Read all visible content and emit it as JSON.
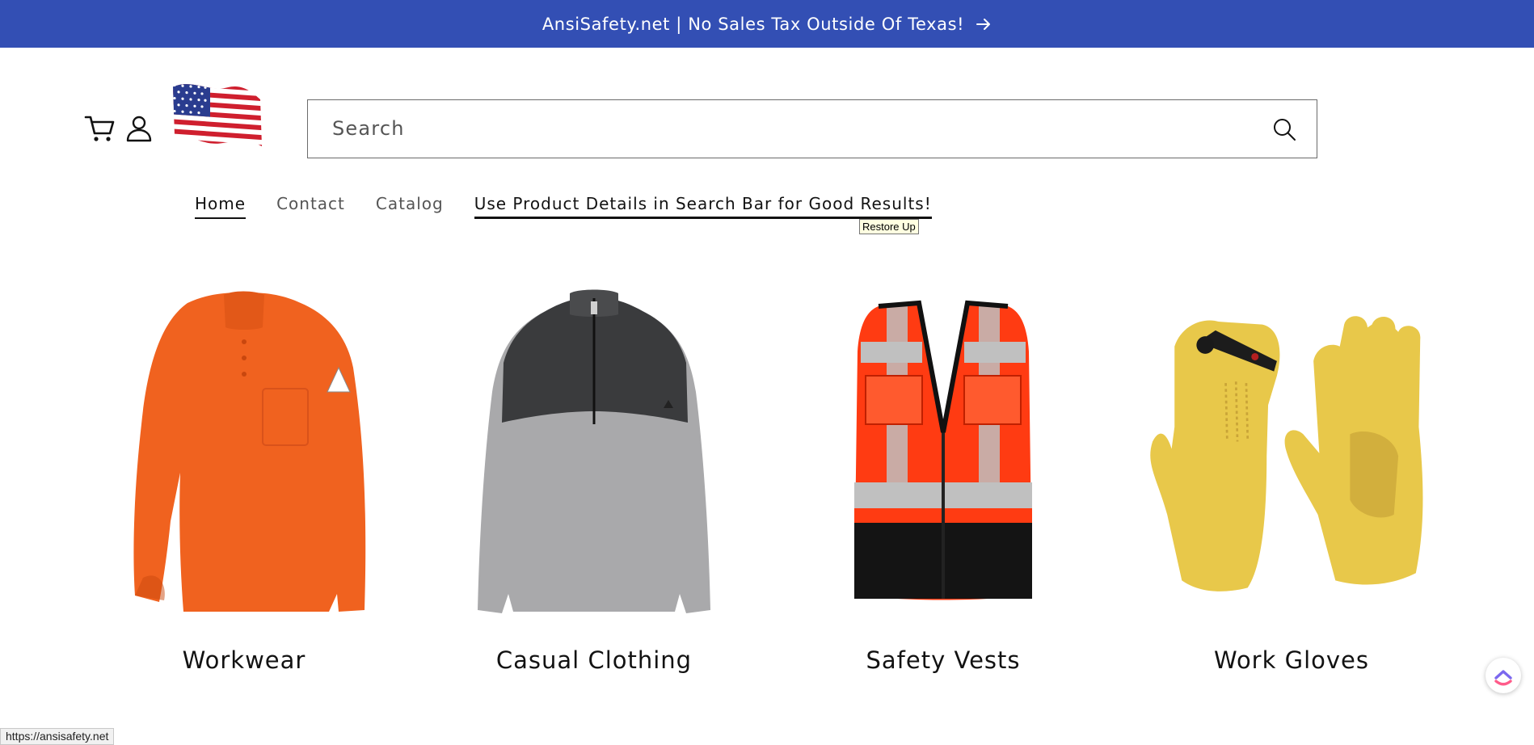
{
  "announcement": {
    "text": "AnsiSafety.net | No Sales Tax Outside Of Texas!",
    "icon": "arrow-right-icon"
  },
  "header": {
    "cart_icon": "cart-icon",
    "account_icon": "account-icon",
    "flag_icon": "us-flag-icon",
    "search": {
      "placeholder": "Search",
      "value": "",
      "icon": "search-icon"
    }
  },
  "nav": {
    "items": [
      {
        "label": "Home"
      },
      {
        "label": "Contact"
      },
      {
        "label": "Catalog"
      },
      {
        "label": "Use Product Details in Search Bar for Good Results!"
      }
    ]
  },
  "tooltip": {
    "text": "Restore Up"
  },
  "collections": [
    {
      "label": "Workwear"
    },
    {
      "label": "Casual Clothing"
    },
    {
      "label": "Safety Vests"
    },
    {
      "label": "Work Gloves"
    }
  ],
  "status_bar": {
    "url": "https://ansisafety.net"
  },
  "colors": {
    "announcement_bg": "#334fb4",
    "text": "#121212"
  }
}
